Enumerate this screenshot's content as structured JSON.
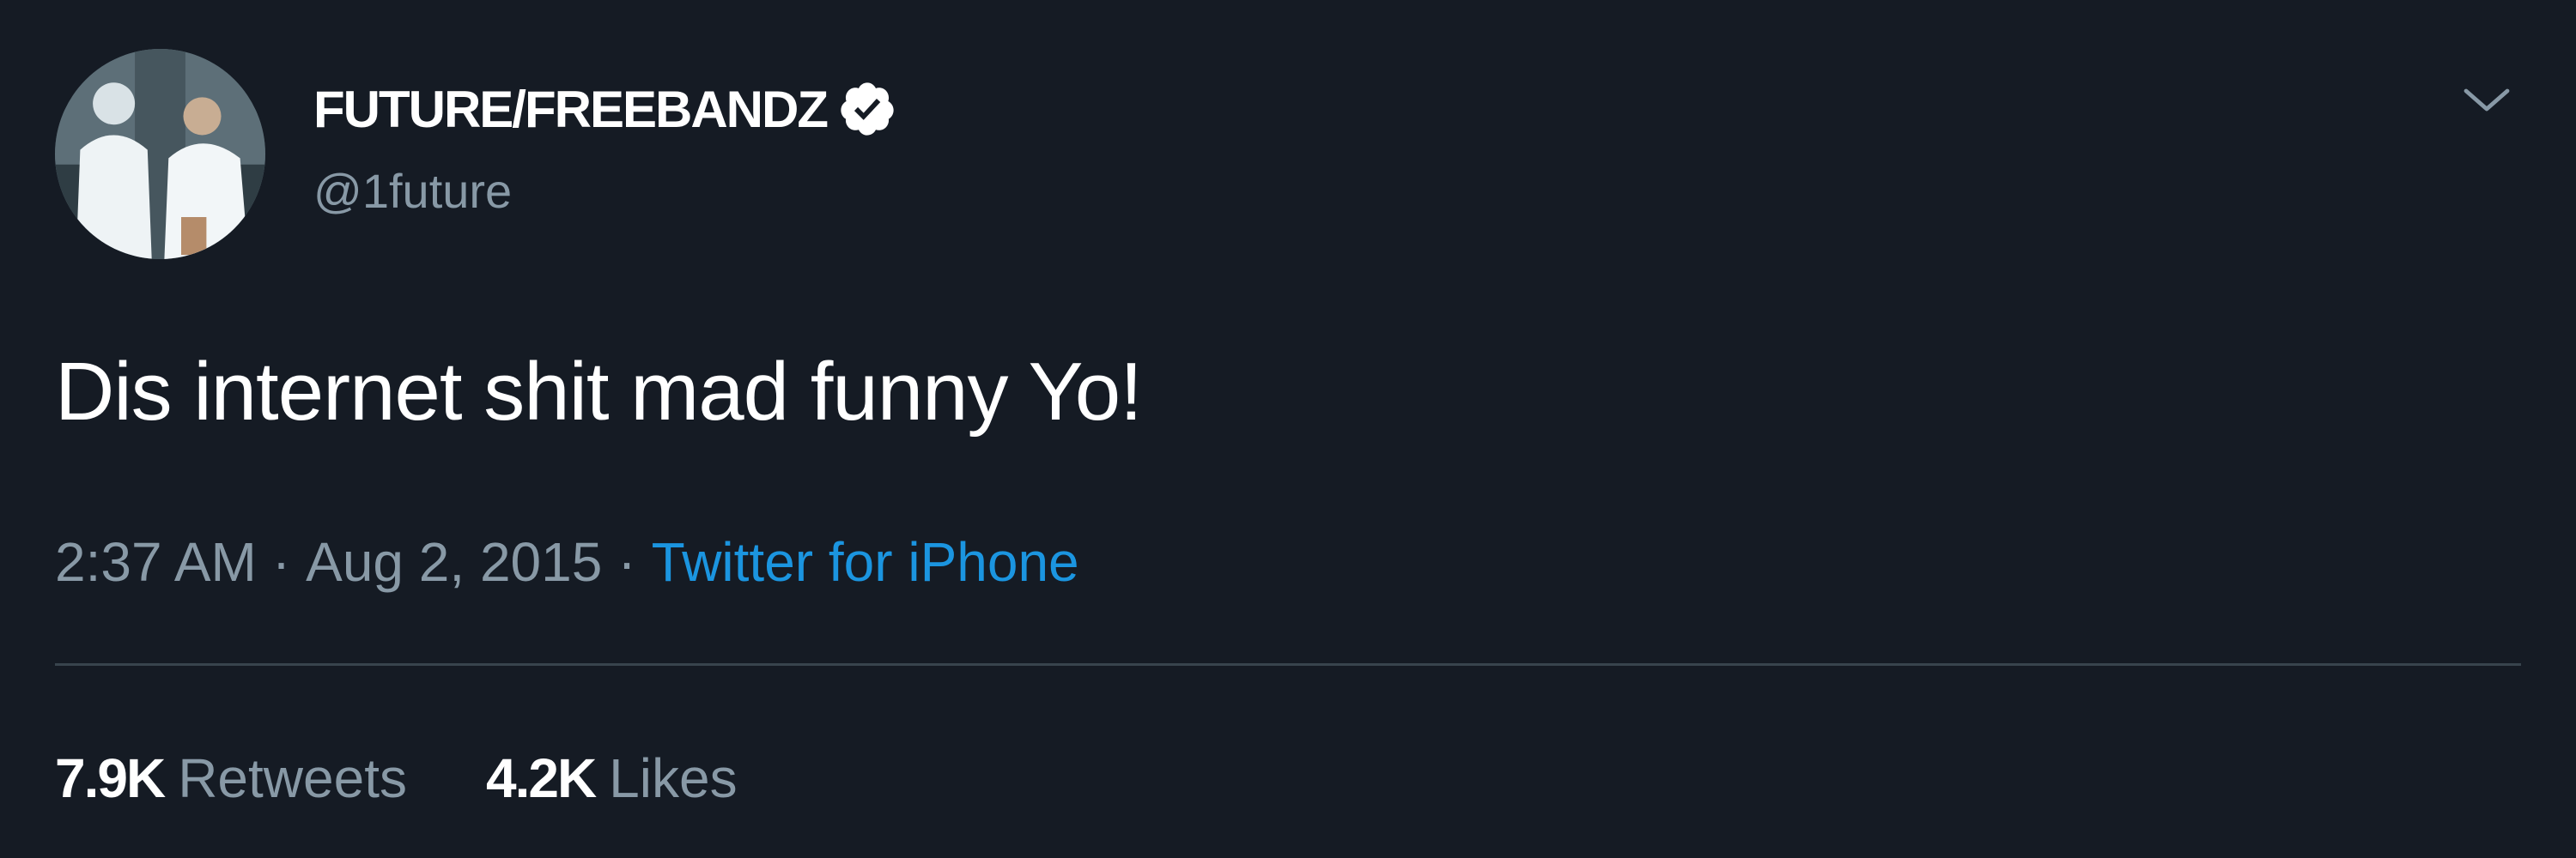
{
  "tweet": {
    "display_name": "FUTURE/FREEBANDZ",
    "handle": "@1future",
    "text": "Dis internet shit mad funny Yo!",
    "time": "2:37 AM",
    "separator": "·",
    "date": "Aug 2, 2015",
    "source": "Twitter for iPhone",
    "retweets": {
      "count": "7.9K",
      "label": "Retweets"
    },
    "likes": {
      "count": "4.2K",
      "label": "Likes"
    },
    "icons": {
      "verified": "verified-badge-icon",
      "menu": "chevron-down-icon"
    }
  },
  "colors": {
    "background": "#151b24",
    "primary_text": "#ffffff",
    "secondary_text": "#8899a6",
    "link": "#1b95e0",
    "divider": "#38444d"
  }
}
